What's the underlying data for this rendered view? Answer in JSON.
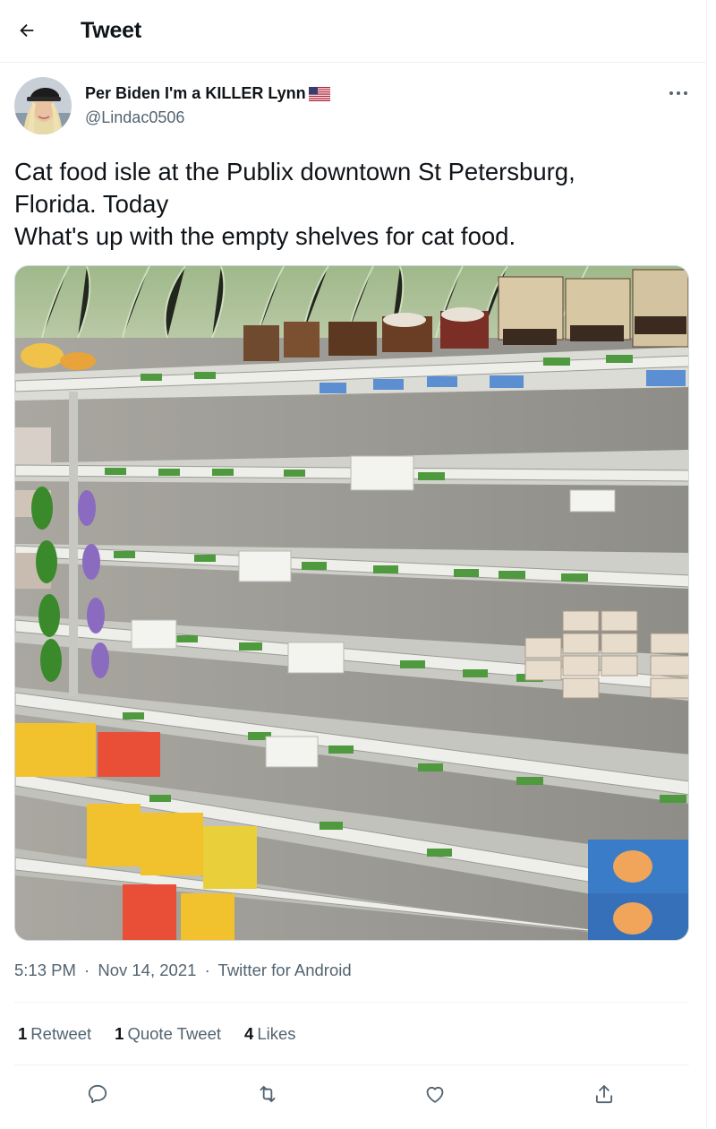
{
  "header": {
    "back_icon": "arrow-left-icon",
    "title": "Tweet"
  },
  "author": {
    "name": "Per Biden I'm a KILLER Lynn",
    "flag_icon": "us-flag-emoji",
    "handle": "@Lindac0506",
    "more_icon": "more-horizontal-icon"
  },
  "tweet": {
    "lines": [
      "Cat food isle at the Publix downtown St Petersburg,",
      "Florida. Today",
      "What's up with the empty shelves for cat food."
    ]
  },
  "meta": {
    "time": "5:13 PM",
    "separator": "·",
    "date": "Nov 14, 2021",
    "source": "Twitter for Android"
  },
  "stats": {
    "retweets_count": "1",
    "retweets_label": "Retweet",
    "quotes_count": "1",
    "quotes_label": "Quote Tweet",
    "likes_count": "4",
    "likes_label": "Likes"
  },
  "actions": {
    "reply_icon": "reply-icon",
    "retweet_icon": "retweet-icon",
    "like_icon": "heart-icon",
    "share_icon": "share-icon"
  },
  "colors": {
    "text_primary": "#0f1419",
    "text_secondary": "#536471",
    "divider": "#eff3f4"
  }
}
